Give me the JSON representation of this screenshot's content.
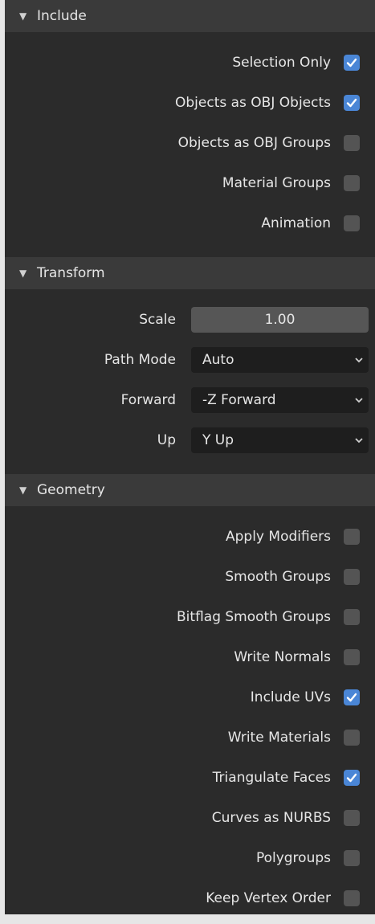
{
  "include": {
    "title": "Include",
    "options": [
      {
        "label": "Selection Only",
        "checked": true
      },
      {
        "label": "Objects as OBJ Objects",
        "checked": true
      },
      {
        "label": "Objects as OBJ Groups",
        "checked": false
      },
      {
        "label": "Material Groups",
        "checked": false
      },
      {
        "label": "Animation",
        "checked": false
      }
    ]
  },
  "transform": {
    "title": "Transform",
    "scale_label": "Scale",
    "scale_value": "1.00",
    "path_mode_label": "Path Mode",
    "path_mode_value": "Auto",
    "forward_label": "Forward",
    "forward_value": "-Z Forward",
    "up_label": "Up",
    "up_value": "Y Up"
  },
  "geometry": {
    "title": "Geometry",
    "options": [
      {
        "label": "Apply Modifiers",
        "checked": false
      },
      {
        "label": "Smooth Groups",
        "checked": false
      },
      {
        "label": "Bitflag Smooth Groups",
        "checked": false
      },
      {
        "label": "Write Normals",
        "checked": false
      },
      {
        "label": "Include UVs",
        "checked": true
      },
      {
        "label": "Write Materials",
        "checked": false
      },
      {
        "label": "Triangulate Faces",
        "checked": true
      },
      {
        "label": "Curves as NURBS",
        "checked": false
      },
      {
        "label": "Polygroups",
        "checked": false
      },
      {
        "label": "Keep Vertex Order",
        "checked": false
      }
    ]
  },
  "colors": {
    "panel_bg": "#2b2b2b",
    "header_bg": "#3a3a3a",
    "checkbox_checked": "#4a86d6",
    "checkbox_unchecked": "#545454",
    "dropdown_bg": "#1e1e1e"
  }
}
